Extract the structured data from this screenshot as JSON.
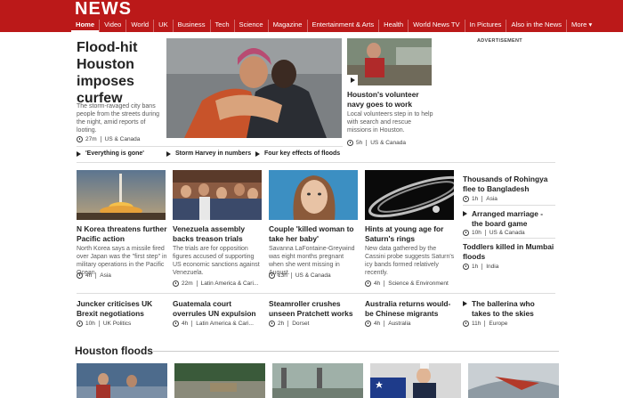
{
  "brand": {
    "logo": "NEWS",
    "accent": "#bb1919"
  },
  "nav": [
    "Home",
    "Video",
    "World",
    "UK",
    "Business",
    "Tech",
    "Science",
    "Magazine",
    "Entertainment & Arts",
    "Health",
    "World News TV",
    "In Pictures",
    "Also in the News",
    "More"
  ],
  "lead": {
    "headline": "Flood-hit Houston imposes curfew",
    "summary": "The storm-ravaged city bans people from the streets during the night, amid reports of looting.",
    "time": "27m",
    "tag": "US & Canada",
    "related": [
      "'Everything is gone'",
      "Storm Harvey in numbers",
      "Four key effects of floods"
    ]
  },
  "second": {
    "headline": "Houston's volunteer navy goes to work",
    "summary": "Local volunteers step in to help with search and rescue missions in Houston.",
    "time": "5h",
    "tag": "US & Canada"
  },
  "advert_label": "ADVERTISEMENT",
  "row2": [
    {
      "headline": "N Korea threatens further Pacific action",
      "summary": "North Korea says a missile fired over Japan was the \"first step\" in military operations in the Pacific Ocean.",
      "time": "4h",
      "tag": "Asia"
    },
    {
      "headline": "Venezuela assembly backs treason trials",
      "summary": "The trials are for opposition figures accused of supporting US economic sanctions against Venezuela.",
      "time": "22m",
      "tag": "Latin America & Cari..."
    },
    {
      "headline": "Couple 'killed woman to take her baby'",
      "summary": "Savanna LaFontaine-Greywind was eight months pregnant when she went missing in August.",
      "time": "13h",
      "tag": "US & Canada"
    },
    {
      "headline": "Hints at young age for Saturn's rings",
      "summary": "New data gathered by the Cassini probe suggests Saturn's icy bands formed relatively recently.",
      "time": "4h",
      "tag": "Science & Environment"
    }
  ],
  "sidebar": [
    {
      "headline": "Thousands of Rohingya flee to Bangladesh",
      "time": "1h",
      "tag": "Asia",
      "video": false
    },
    {
      "headline": "Arranged marriage - the board game",
      "time": "10h",
      "tag": "US & Canada",
      "video": true
    },
    {
      "headline": "Toddlers killed in Mumbai floods",
      "time": "1h",
      "tag": "India",
      "video": false
    }
  ],
  "row3": [
    {
      "headline": "Juncker criticises UK Brexit negotiations",
      "time": "10h",
      "tag": "UK Politics",
      "video": false
    },
    {
      "headline": "Guatemala court overrules UN expulsion",
      "time": "4h",
      "tag": "Latin America & Cari...",
      "video": false
    },
    {
      "headline": "Steamroller crushes unseen Pratchett works",
      "time": "2h",
      "tag": "Dorset",
      "video": false
    },
    {
      "headline": "Australia returns would-be Chinese migrants",
      "time": "4h",
      "tag": "Australia",
      "video": false
    },
    {
      "headline": "The ballerina who takes to the skies",
      "time": "11h",
      "tag": "Europe",
      "video": true
    }
  ],
  "section": {
    "title": "Houston floods"
  }
}
